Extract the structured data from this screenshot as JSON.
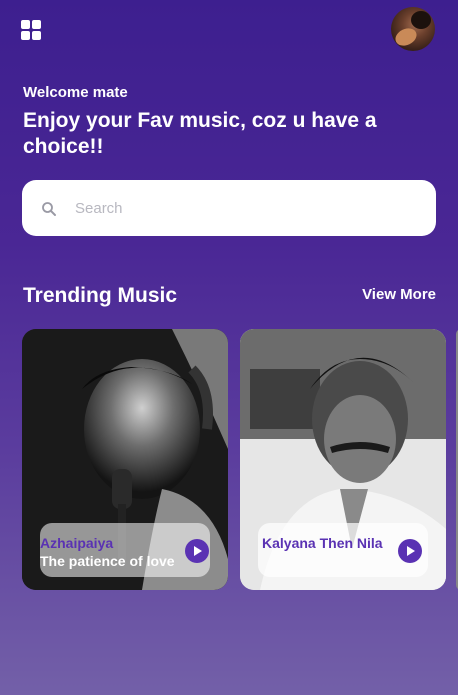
{
  "header": {
    "menu_icon": "grid-menu-icon",
    "avatar_icon": "user-avatar"
  },
  "greeting": {
    "welcome": "Welcome mate",
    "headline": "Enjoy your Fav music, coz u have a choice!!"
  },
  "search": {
    "placeholder": "Search",
    "value": "",
    "icon": "search-icon"
  },
  "trending": {
    "title": "Trending Music",
    "view_more": "View More",
    "cards": [
      {
        "title": "Azhaipaiya",
        "subtitle": "The patience of love",
        "icon": "play-icon"
      },
      {
        "title": "Kalyana Then Nila",
        "subtitle": "",
        "icon": "play-icon"
      }
    ]
  },
  "colors": {
    "accent": "#5a32b3",
    "background_top": "#3d1f8f",
    "background_bottom": "#7360a8"
  }
}
